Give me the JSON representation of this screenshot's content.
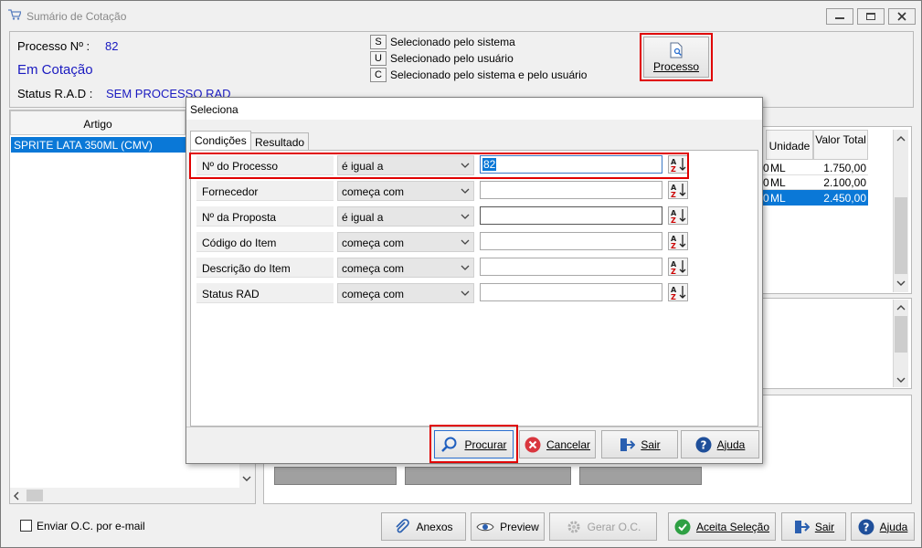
{
  "window": {
    "title": "Sumário de Cotação"
  },
  "header": {
    "processo_label": "Processo Nº :",
    "processo_value": "82",
    "status_cotacao": "Em Cotação",
    "status_rad_label": "Status R.A.D :",
    "status_rad_value": "SEM PROCESSO RAD"
  },
  "legend": [
    {
      "key": "S",
      "label": "Selecionado pelo sistema"
    },
    {
      "key": "U",
      "label": "Selecionado pelo usuário"
    },
    {
      "key": "C",
      "label": "Selecionado pelo sistema e pelo usuário"
    }
  ],
  "processo_button": {
    "label": "Processo"
  },
  "left_grid": {
    "header": "Artigo",
    "rows": [
      "SPRITE LATA 350ML (CMV)"
    ]
  },
  "right_grid": {
    "headers": [
      "Unidade",
      "Valor Total"
    ],
    "rows": [
      {
        "cut": "0",
        "unidade": "ML",
        "valor": "1.750,00"
      },
      {
        "cut": "0",
        "unidade": "ML",
        "valor": "2.100,00"
      },
      {
        "cut": "0",
        "unidade": "ML",
        "valor": "2.450,00"
      }
    ]
  },
  "dialog": {
    "title": "Seleciona",
    "tabs": [
      "Condições",
      "Resultado"
    ],
    "conditions": [
      {
        "field": "Nº do Processo",
        "operator": "é igual a",
        "value": "82"
      },
      {
        "field": "Fornecedor",
        "operator": "começa com",
        "value": ""
      },
      {
        "field": "Nº da Proposta",
        "operator": "é igual a",
        "value": ""
      },
      {
        "field": "Código do Item",
        "operator": "começa com",
        "value": ""
      },
      {
        "field": "Descrição do Item",
        "operator": "começa com",
        "value": ""
      },
      {
        "field": "Status RAD",
        "operator": "começa com",
        "value": ""
      }
    ],
    "buttons": {
      "procurar": "Procurar",
      "cancelar": "Cancelar",
      "sair": "Sair",
      "ajuda": "Ajuda"
    }
  },
  "footer": {
    "email_checkbox": "Enviar O.C. por e-mail",
    "anexos": "Anexos",
    "preview": "Preview",
    "gerar_oc": "Gerar O.C.",
    "aceita": "Aceita Seleção",
    "sair": "Sair",
    "ajuda": "Ajuda"
  },
  "colors": {
    "selection": "#0a78d7",
    "highlight": "#e00000",
    "accent_blue": "#1a1ac0"
  }
}
